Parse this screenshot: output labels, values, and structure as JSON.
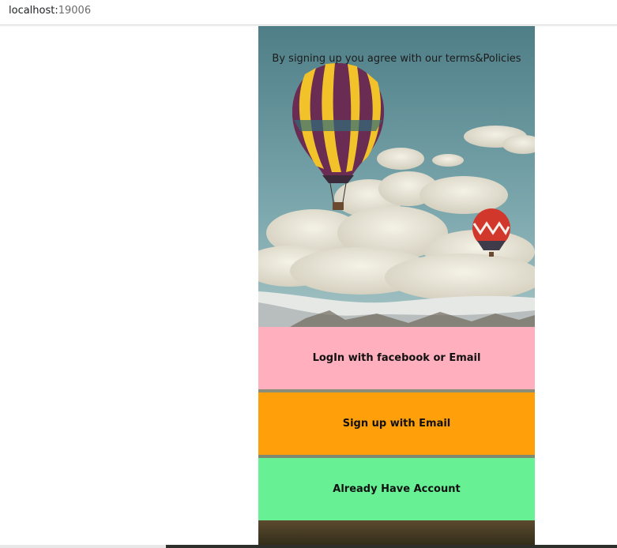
{
  "browser": {
    "host": "localhost:",
    "port": "19006"
  },
  "screen": {
    "terms_text": "By signing up you agree with our terms&Policies",
    "buttons": {
      "login": "LogIn with facebook or Email",
      "signup": "Sign up with Email",
      "existing": "Already Have Account"
    }
  },
  "colors": {
    "login_bg": "#ffafbd",
    "signup_bg": "#ff9f0a",
    "existing_bg": "#67f094"
  },
  "background_image": "hot-air-balloons-over-clouds-and-mountains"
}
